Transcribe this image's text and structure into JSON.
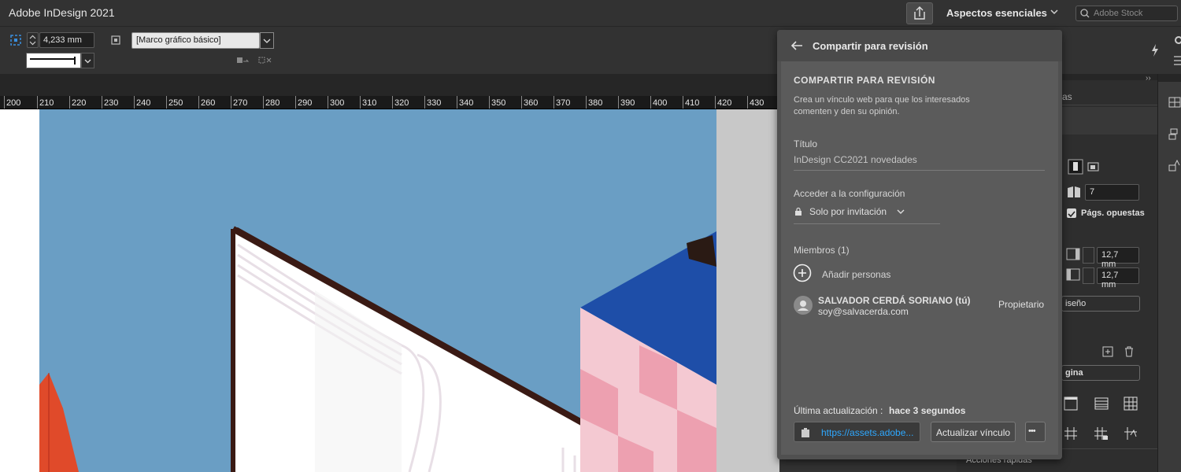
{
  "titlebar": {
    "app_title": "Adobe InDesign 2021",
    "workspace": "Aspectos esenciales",
    "stock_placeholder": "Adobe Stock"
  },
  "controlbar": {
    "stroke_weight": "4,233 mm",
    "frame_style": "[Marco gráfico básico]"
  },
  "ruler": {
    "ticks": [
      "200",
      "210",
      "220",
      "230",
      "240",
      "250",
      "260",
      "270",
      "280",
      "290",
      "300",
      "310",
      "320",
      "330",
      "340",
      "350",
      "360",
      "370",
      "380",
      "390",
      "400",
      "410",
      "420",
      "430"
    ]
  },
  "share_panel": {
    "header_title": "Compartir para revisión",
    "section_title": "COMPARTIR PARA REVISIÓN",
    "description_line1": "Crea un vínculo web para que los interesados",
    "description_line2": "comenten y den su opinión.",
    "title_label": "Título",
    "title_value": "InDesign CC2021 novedades",
    "access_label": "Acceder a la configuración",
    "access_value": "Solo por invitación",
    "members_label": "Miembros (1)",
    "add_people": "Añadir personas",
    "member": {
      "name": "SALVADOR CERDÁ SORIANO (tú)",
      "email": "soy@salvacerda.com",
      "role": "Propietario"
    },
    "last_update_label": "Última actualización :",
    "last_update_value": "hace 3 segundos",
    "link": "https://assets.adobe...",
    "update_link_button": "Actualizar vínculo",
    "more_button": "•••"
  },
  "right_panel": {
    "tab_fragment": "as",
    "pages_count": "7",
    "facing_pages_label": "Págs. opuestas",
    "margin_1": "12,7 mm",
    "margin_2": "12,7 mm",
    "layout_button_fragment": "iseño",
    "page_fragment": "gina",
    "quick_actions": "Acciones rápidas"
  },
  "colors": {
    "sky": "#6a9ec4",
    "accent_link": "#2ea8ff",
    "panel_bg": "#5b5b5b"
  }
}
